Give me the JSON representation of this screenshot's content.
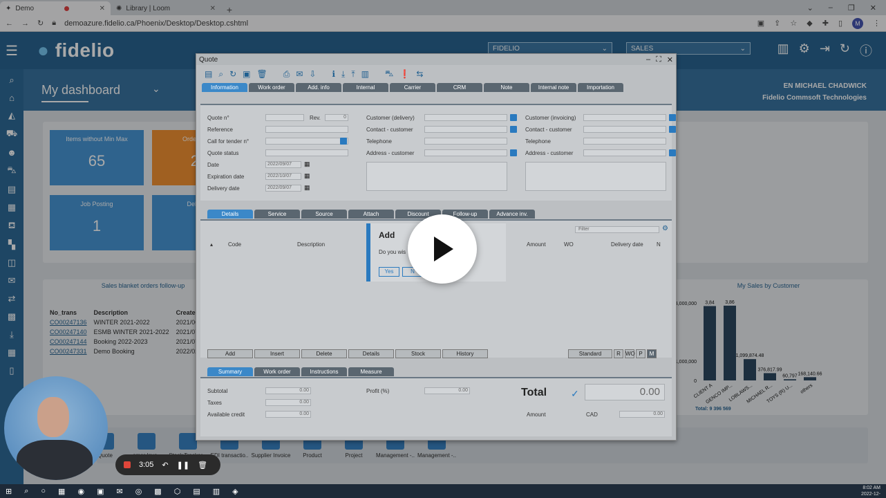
{
  "browser": {
    "tabs": [
      {
        "label": "Demo"
      },
      {
        "label": "Library | Loom"
      }
    ],
    "url": "demoazure.fidelio.ca/Phoenix/Desktop/Desktop.cshtml",
    "avatar_letter": "M"
  },
  "app": {
    "logo": "fidelio",
    "company_select": "FIDELIO",
    "module_select": "SALES",
    "dashboard_title": "My dashboard",
    "user_name": "EN MICHAEL CHADWICK",
    "company_name": "Fidelio Commsoft Technologies",
    "tiles": [
      {
        "title": "Items without Min Max",
        "value": "65",
        "color": "#3a8ed2"
      },
      {
        "title": "Order vs Pu",
        "value": "23",
        "color": "#f08a24"
      },
      {
        "title": "Job Posting",
        "value": "1",
        "color": "#3a8ed2"
      },
      {
        "title": "Deliverin",
        "value": "",
        "color": "#3a8ed2"
      }
    ],
    "blanket": {
      "title": "Sales blanket orders follow-up",
      "headers": [
        "No_trans",
        "Description",
        "Created_d"
      ],
      "rows": [
        [
          "CO00247136",
          "WINTER 2021-2022",
          "2021/06/28"
        ],
        [
          "CO00247140",
          "ESMB WINTER 2021-2022",
          "2021/07/05"
        ],
        [
          "CO00247144",
          "Booking 2022-2023",
          "2021/07/06"
        ],
        [
          "CO00247331",
          "Demo Booking",
          "2022/02/01"
        ]
      ]
    },
    "dock": [
      "Quote",
      "omer Invo..",
      "Stock Tracker ..",
      "EDI transactio..",
      "Supplier Invoice",
      "Product",
      "Project",
      "Management -..",
      "Management -.."
    ]
  },
  "modal": {
    "title": "Quote",
    "top_tabs": [
      "Information",
      "Work order",
      "Add. info",
      "Internal",
      "Carrier",
      "CRM",
      "Note",
      "Internal note",
      "Importation"
    ],
    "fields_left": [
      "Quote n°",
      "Reference",
      "Call for tender n°",
      "Quote status",
      "Date",
      "Expiration date",
      "Delivery date"
    ],
    "rev_label": "Rev.",
    "rev_value": "0",
    "dates": [
      "2022/09/07",
      "2022/10/07",
      "2022/09/07"
    ],
    "fields_mid": [
      "Customer (delivery)",
      "Contact - customer",
      "Telephone",
      "Address - customer"
    ],
    "fields_right": [
      "Customer (invoicing)",
      "Contact - customer",
      "Telephone",
      "Address - customer"
    ],
    "detail_tabs": [
      "Details",
      "Service",
      "Source",
      "Attach",
      "Discount",
      "Follow-up",
      "Advance inv."
    ],
    "grid_headers": [
      "Code",
      "Description",
      "Amount",
      "WO",
      "Delivery date",
      "N"
    ],
    "filter_placeholder": "Filter",
    "row_buttons": [
      "Add",
      "Insert",
      "Delete",
      "Details",
      "Stock",
      "History"
    ],
    "right_buttons": [
      "Standard",
      "R",
      "WO",
      "P",
      "M"
    ],
    "summary_tabs": [
      "Summary",
      "Work order",
      "Instructions",
      "Measure"
    ],
    "summary": [
      {
        "label": "Subtotal",
        "value": "0.00"
      },
      {
        "label": "Taxes",
        "value": "0.00"
      },
      {
        "label": "Available credit",
        "value": "0.00"
      }
    ],
    "profit_label": "Profit (%)",
    "profit_value": "0.00",
    "total_label": "Total",
    "total_value": "0.00",
    "amount_label": "Amount",
    "currency": "CAD",
    "amount_value": "0.00"
  },
  "dialog": {
    "title": "Add",
    "body": "Do you wis",
    "yes": "Yes",
    "no": "N"
  },
  "chart_data": {
    "type": "bar",
    "title": "My Sales by Customer",
    "categories": [
      "CLIENT A",
      "GENCO IMP...",
      "LOBLAWS...",
      "MICHAEL R...",
      "TOYS (R) U...",
      "others"
    ],
    "values": [
      3840000,
      3860000,
      1099874.48,
      376817.99,
      60797,
      168140.66
    ],
    "data_labels": [
      "3,84",
      "3,86",
      "1,099,874.48",
      "376,817.99",
      "60,797",
      "168,140.66"
    ],
    "y_ticks": [
      "4,000,000",
      "1,000,000",
      "0"
    ],
    "ylim": [
      0,
      4000000
    ],
    "total_label": "Total: 9 396 569"
  },
  "recorder": {
    "time": "3:05"
  },
  "taskbar": {
    "time": "8:02 AM",
    "date": "2022-12-"
  }
}
